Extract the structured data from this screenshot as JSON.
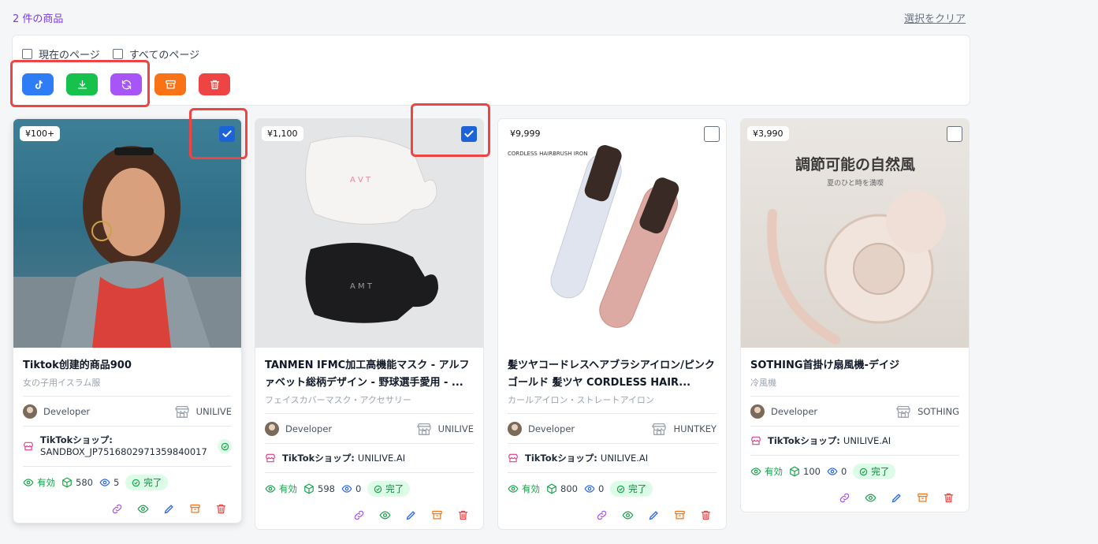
{
  "header": {
    "count": "2 件の商品",
    "clear": "選択をクリア"
  },
  "toolbar": {
    "current_page": "現在のページ",
    "all_pages": "すべてのページ"
  },
  "colors": {
    "tiktok": "#2e7cf6",
    "download": "#16c24c",
    "sync": "#a855f7",
    "archive": "#f97316",
    "delete": "#ef4444",
    "highlight": "#ef4444"
  },
  "cards": [
    {
      "price": "¥100+",
      "title": "Tiktok创建的商品900",
      "subtitle": "女の子用イスラム服",
      "developer": "Developer",
      "store": "UNILIVE",
      "shop_label": "TikTokショップ:",
      "shop_value": "SANDBOX_JP7516802971359840017",
      "status_active": "有効",
      "stock": "580",
      "views": "5",
      "state": "完了",
      "checked": true
    },
    {
      "price": "¥1,100",
      "title": "TANMEN IFMC加工高機能マスク - アルファベット総柄デザイン - 野球選手愛用 - ...",
      "subtitle": "フェイスカバーマスク・アクセサリー",
      "developer": "Developer",
      "store": "UNILIVE",
      "shop_label": "TikTokショップ:",
      "shop_value": "UNILIVE.AI",
      "status_active": "有効",
      "stock": "598",
      "views": "0",
      "state": "完了",
      "checked": true
    },
    {
      "price": "¥9,999",
      "title": "髪ツヤコードレスヘアブラシアイロン/ピンクゴールド 髪ツヤ CORDLESS HAIR...",
      "subtitle": "カールアイロン・ストレートアイロン",
      "developer": "Developer",
      "store": "HUNTKEY",
      "shop_label": "TikTokショップ:",
      "shop_value": "UNILIVE.AI",
      "status_active": "有効",
      "stock": "800",
      "views": "0",
      "state": "完了",
      "checked": false,
      "image_text": "CORDLESS HAIRBRUSH IRON"
    },
    {
      "price": "¥3,990",
      "title": "SOTHING首掛け扇風機-デイジ",
      "subtitle": "冷風機",
      "developer": "Developer",
      "store": "SOTHING",
      "shop_label": "TikTokショップ:",
      "shop_value": "UNILIVE.AI",
      "status_active": "有効",
      "stock": "100",
      "views": "0",
      "state": "完了",
      "checked": false,
      "image_text": "調節可能の自然風",
      "image_subtext": "夏のひと時を満喫"
    }
  ]
}
